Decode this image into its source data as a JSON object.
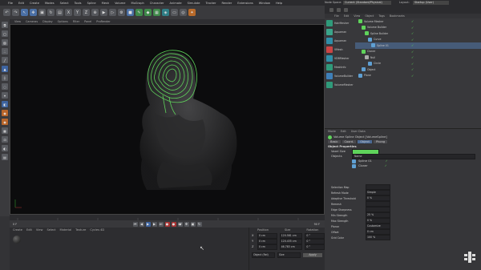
{
  "menubar": {
    "items": [
      "File",
      "Edit",
      "Create",
      "Modes",
      "Select",
      "Tools",
      "Spline",
      "Mesh",
      "Volume",
      "MoGraph",
      "Character",
      "Animate",
      "Simulate",
      "Tracker",
      "Render",
      "Extensions",
      "Window",
      "Help"
    ],
    "layout_label": "Node Space:",
    "layout_value": "Current (Standard/Physical)",
    "layout_right": "Layout:",
    "layout_right_value": "Startup (User)"
  },
  "viewport_menu": [
    "View",
    "Cameras",
    "Display",
    "Options",
    "Filter",
    "Panel",
    "ProRender"
  ],
  "plugins": {
    "items": [
      "HairMesher",
      "Aquaman",
      "Aquaman",
      "VMesh",
      "VDBMesher",
      "MeshInfo",
      "VolumeBuilder",
      "VolumeMesher"
    ]
  },
  "objects": {
    "menu": [
      "File",
      "Edit",
      "View",
      "Object",
      "Tags",
      "Bookmarks"
    ],
    "rows": [
      "Volume Mesher",
      "Volume Builder",
      "Spline Builder",
      "Curve",
      "Spline 01",
      "Cloner",
      "Null",
      "Circle",
      "Object",
      "Plane"
    ]
  },
  "attributes": {
    "menu": [
      "Mode",
      "Edit",
      "User Data"
    ],
    "title": "Volume Spline Object [VolumeSpline]",
    "tabs": [
      "Basic",
      "Coord.",
      "Object",
      "Phong"
    ],
    "section": "Object Properties",
    "rows": [
      {
        "label": "Voxel Size",
        "value": "2 cm"
      },
      {
        "label": "Objects",
        "value": "Name"
      },
      {
        "label": "",
        "value": "Spline 01"
      },
      {
        "label": "",
        "value": "Cloner"
      }
    ],
    "lower": [
      {
        "label": "Selection Map",
        "value": ""
      },
      {
        "label": "Refresh Mode",
        "value": "Simple"
      },
      {
        "label": "Adaptive Threshold",
        "value": "0 %"
      },
      {
        "label": "Remesh",
        "value": ""
      },
      {
        "label": "Edge Sharpness",
        "value": ""
      },
      {
        "label": "Min Strength",
        "value": "25 %"
      },
      {
        "label": "Max Strength",
        "value": "0 %"
      },
      {
        "label": "Planar",
        "value": "Customize"
      },
      {
        "label": "Offset",
        "value": "0 cm"
      },
      {
        "label": "Grid Color",
        "value": "100 %"
      }
    ]
  },
  "playbar": {
    "frame_start": "0 F",
    "frame_end": "90 F",
    "current": "0 F"
  },
  "material": {
    "menu": [
      "Create",
      "Edit",
      "View",
      "Select",
      "Material",
      "Texture",
      "Cycles 4D"
    ]
  },
  "coords": {
    "headers": [
      "Position",
      "Size",
      "Rotation"
    ],
    "rows": [
      {
        "axis": "X",
        "pos": "0 cm",
        "size": "120.581 cm",
        "rot": "0 °"
      },
      {
        "axis": "Y",
        "pos": "0 cm",
        "size": "120.435 cm",
        "rot": "0 °"
      },
      {
        "axis": "Z",
        "pos": "0 cm",
        "size": "46.783 cm",
        "rot": "0 °"
      }
    ],
    "mode": "Object (Rel)",
    "size_mode": "Size",
    "apply": "Apply"
  },
  "colors": {
    "green_spline": "#5fd35b",
    "accent_blue": "#3e64a0",
    "active_row": "#465b78"
  }
}
